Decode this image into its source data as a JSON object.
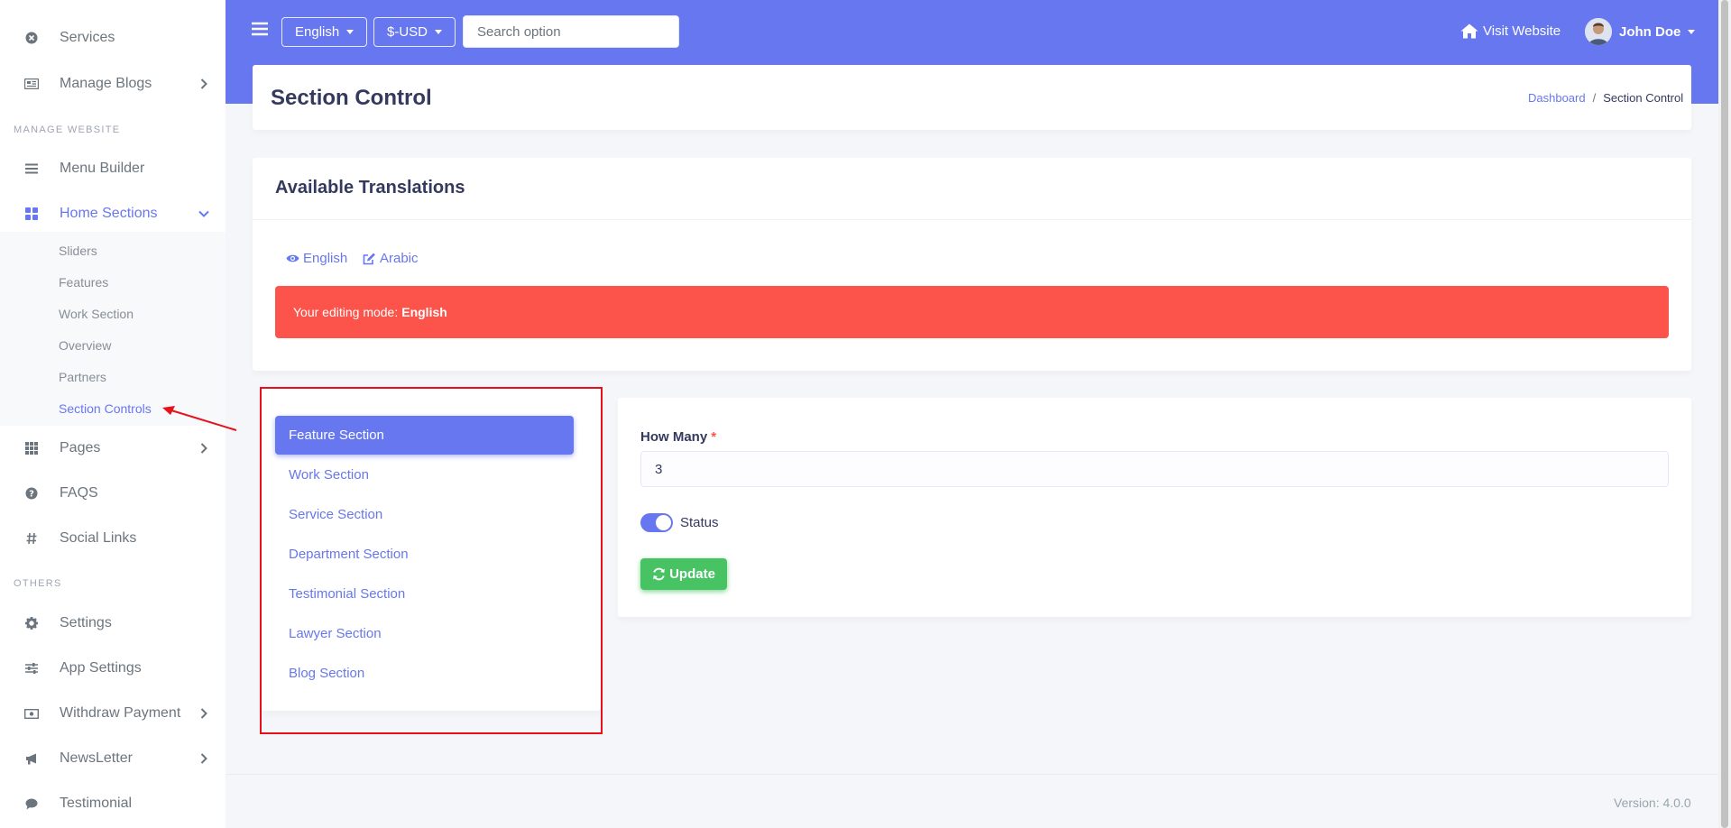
{
  "sidebar": {
    "items_top": [
      {
        "label": "Services",
        "icon": "times-circle-icon"
      },
      {
        "label": "Manage Blogs",
        "icon": "newspaper-icon"
      }
    ],
    "heading_manage": "MANAGE WEBSITE",
    "menu_builder": {
      "label": "Menu Builder",
      "icon": "bars-icon"
    },
    "home_sections": {
      "label": "Home Sections",
      "icon": "th-large-icon"
    },
    "sub_items": [
      {
        "label": "Sliders"
      },
      {
        "label": "Features"
      },
      {
        "label": "Work Section"
      },
      {
        "label": "Overview"
      },
      {
        "label": "Partners"
      },
      {
        "label": "Section Controls"
      }
    ],
    "items_mid": [
      {
        "label": "Pages",
        "icon": "th-icon"
      },
      {
        "label": "FAQS",
        "icon": "question-circle-icon"
      },
      {
        "label": "Social Links",
        "icon": "hashtag-icon"
      }
    ],
    "heading_others": "OTHERS",
    "items_bottom": [
      {
        "label": "Settings",
        "icon": "cog-icon"
      },
      {
        "label": "App Settings",
        "icon": "sliders-icon"
      },
      {
        "label": "Withdraw Payment",
        "icon": "money-bill-icon"
      },
      {
        "label": "NewsLetter",
        "icon": "bullhorn-icon"
      },
      {
        "label": "Testimonial",
        "icon": "comment-icon"
      }
    ]
  },
  "header": {
    "language": "English",
    "currency": "$-USD",
    "search_placeholder": "Search option",
    "visit_website": "Visit Website",
    "user_name": "John Doe"
  },
  "page": {
    "title": "Section Control",
    "breadcrumb": {
      "home": "Dashboard",
      "separator": "/",
      "current": "Section Control"
    }
  },
  "translations": {
    "title": "Available Translations",
    "languages": [
      {
        "label": "English",
        "icon": "eye-icon"
      },
      {
        "label": "Arabic",
        "icon": "edit-icon"
      }
    ],
    "alert_prefix": "Your editing mode:",
    "alert_lang": "English"
  },
  "sections": {
    "tabs": [
      {
        "label": "Feature Section",
        "active": true
      },
      {
        "label": "Work Section"
      },
      {
        "label": "Service Section"
      },
      {
        "label": "Department Section"
      },
      {
        "label": "Testimonial Section"
      },
      {
        "label": "Lawyer Section"
      },
      {
        "label": "Blog Section"
      }
    ]
  },
  "form": {
    "how_many_label": "How Many",
    "required_mark": "*",
    "how_many_value": "3",
    "status_label": "Status",
    "status_on": true,
    "update_label": "Update"
  },
  "footer": {
    "version": "Version: 4.0.0"
  },
  "colors": {
    "primary": "#6777ef",
    "danger": "#fc544b",
    "success": "#47c363",
    "annotation": "#e8101a"
  }
}
